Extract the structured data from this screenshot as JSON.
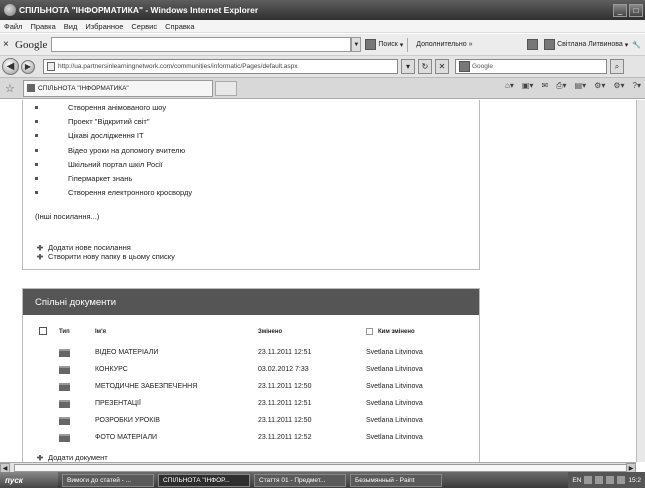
{
  "window": {
    "title": "СПІЛЬНОТА \"ІНФОРМАТИКА\" - Windows Internet Explorer",
    "minimize": "_",
    "maximize": "□"
  },
  "menu": [
    "Файл",
    "Правка",
    "Вид",
    "Избранное",
    "Сервис",
    "Справка"
  ],
  "google_toolbar": {
    "close": "×",
    "logo": "Google",
    "search_button": "Поиск",
    "more_button": "Дополнительно »",
    "user": "Світлана Литвинова"
  },
  "address_bar": {
    "url": "http://ua.partnersinlearningnetwork.com/communities/informatic/Pages/default.aspx",
    "search_placeholder": "Google",
    "back": "◀",
    "forward": "▶"
  },
  "tabs": [
    {
      "label": "СПІЛЬНОТА \"ІНФОРМАТИКА\""
    }
  ],
  "links_panel": {
    "items": [
      "Створення анімованого шоу",
      "Проект \"Відкритий світ\"",
      "Цікаві дослідження ІТ",
      "Відео уроки на допомогу вчителю",
      "Шкільний портал шкіл Росії",
      "Гіпермаркет знань",
      "Створення електронного кросворду"
    ],
    "more": "(Інші посилання...)",
    "add_link": "Додати нове посилання",
    "create_folder": "Створити нову папку в цьому списку"
  },
  "docs_panel": {
    "header": "Спільні документи",
    "columns": {
      "type": "Тип",
      "name": "Ім'я",
      "modified": "Змінено",
      "modified_by": "Ким змінено"
    },
    "rows": [
      {
        "name": "ВІДЕО МАТЕРІАЛИ",
        "modified": "23.11.2011 12:51",
        "by": "Svetlana Litvinova"
      },
      {
        "name": "КОНКУРС",
        "modified": "03.02.2012 7:33",
        "by": "Svetlana Litvinova"
      },
      {
        "name": "МЕТОДИЧНЕ ЗАБЕЗПЕЧЕННЯ",
        "modified": "23.11.2011 12:50",
        "by": "Svetlana Litvinova"
      },
      {
        "name": "ПРЕЗЕНТАЦІЇ",
        "modified": "23.11.2011 12:51",
        "by": "Svetlana Litvinova"
      },
      {
        "name": "РОЗРОБКИ УРОКІВ",
        "modified": "23.11.2011 12:50",
        "by": "Svetlana Litvinova"
      },
      {
        "name": "ФОТО МАТЕРІАЛИ",
        "modified": "23.11.2011 12:52",
        "by": "Svetlana Litvinova"
      }
    ],
    "add_document": "Додати документ"
  },
  "taskbar": {
    "start": "пуск",
    "tasks": [
      {
        "label": "Вимоги до статей - ..."
      },
      {
        "label": "СПІЛЬНОТА \"ІНФОР..."
      },
      {
        "label": "Стаття 01 - Предмет..."
      },
      {
        "label": "Безымянный - Paint"
      }
    ],
    "lang": "EN",
    "clock": "15:2"
  },
  "colors": {
    "panel_header": "#555555",
    "title_bar": "#3a3a3a"
  }
}
